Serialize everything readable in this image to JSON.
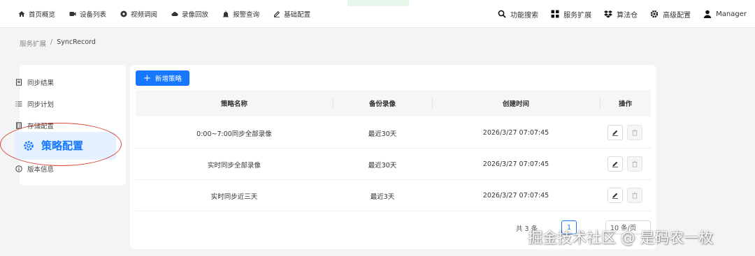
{
  "topnav": {
    "left": [
      {
        "icon": "home-icon",
        "label": "首页概览"
      },
      {
        "icon": "camera-icon",
        "label": "设备列表"
      },
      {
        "icon": "play-circle-icon",
        "label": "视频调阅"
      },
      {
        "icon": "cloud-icon",
        "label": "录像回放"
      },
      {
        "icon": "alarm-icon",
        "label": "报警查询"
      },
      {
        "icon": "pencil-icon",
        "label": "基础配置"
      }
    ],
    "right": [
      {
        "icon": "search-icon",
        "label": "功能搜索"
      },
      {
        "icon": "grid-icon",
        "label": "服务扩展"
      },
      {
        "icon": "dropbox-icon",
        "label": "算法仓"
      },
      {
        "icon": "gear-icon",
        "label": "高级配置"
      },
      {
        "icon": "user-icon",
        "label": "Manager"
      }
    ]
  },
  "breadcrumb": {
    "root": "服务扩展",
    "sep": "/",
    "current": "SyncRecord"
  },
  "sidebar": {
    "items": [
      {
        "icon": "document-icon",
        "label": "同步结果"
      },
      {
        "icon": "list-icon",
        "label": "同步计划"
      },
      {
        "icon": "storage-icon",
        "label": "存储配置"
      },
      {
        "icon": "gear-icon",
        "label": "策略配置"
      },
      {
        "icon": "info-icon",
        "label": "版本信息"
      }
    ],
    "active_index": 3
  },
  "toolbar": {
    "add_label": "新增策略"
  },
  "table": {
    "headers": [
      "策略名称",
      "备份录像",
      "创建时间",
      "操作"
    ],
    "rows": [
      {
        "name": "0:00~7:00同步全部录像",
        "backup": "最近30天",
        "created": "2026/3/27 07:07:45"
      },
      {
        "name": "实时同步全部录像",
        "backup": "最近30天",
        "created": "2026/3/27 07:07:45"
      },
      {
        "name": "实时同步近三天",
        "backup": "最近3天",
        "created": "2026/3/27 07:07:45"
      }
    ]
  },
  "pagination": {
    "total": "共 3 条",
    "page": "1",
    "page_size": "10 条/页"
  },
  "watermark": "掘金技术社区 @ 是码农一枚",
  "colors": {
    "accent": "#1677ff",
    "annotation": "#d8483b"
  }
}
